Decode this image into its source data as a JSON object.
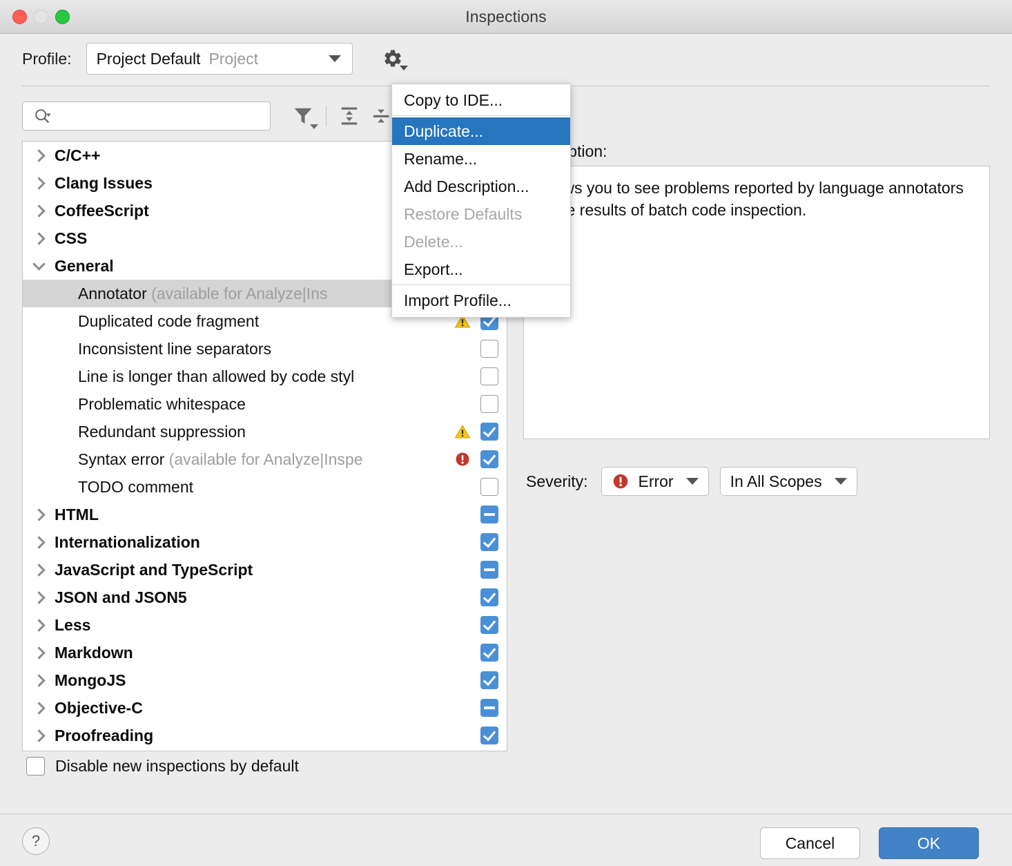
{
  "window": {
    "title": "Inspections"
  },
  "profile": {
    "label": "Profile:",
    "name": "Project Default",
    "scope": "Project",
    "gear_icon": "gear-icon"
  },
  "toolbar": {
    "search_placeholder": "",
    "search_value": "",
    "filter_icon": "filter-icon",
    "expand_all_icon": "expand-all-icon",
    "collapse_all_icon": "collapse-all-icon"
  },
  "menu": {
    "items": [
      {
        "label": "Copy to IDE...",
        "state": "normal"
      },
      {
        "separator": true
      },
      {
        "label": "Duplicate...",
        "state": "highlight"
      },
      {
        "label": "Rename...",
        "state": "normal"
      },
      {
        "label": "Add Description...",
        "state": "normal"
      },
      {
        "label": "Restore Defaults",
        "state": "disabled"
      },
      {
        "label": "Delete...",
        "state": "disabled"
      },
      {
        "label": "Export...",
        "state": "normal"
      },
      {
        "separator": true
      },
      {
        "label": "Import Profile...",
        "state": "normal"
      }
    ]
  },
  "tree": {
    "rows": [
      {
        "type": "group",
        "label": "C/C++",
        "twisty": "closed",
        "check": null,
        "sev": null
      },
      {
        "type": "group",
        "label": "Clang Issues",
        "twisty": "closed",
        "check": null,
        "sev": null
      },
      {
        "type": "group",
        "label": "CoffeeScript",
        "twisty": "closed",
        "check": null,
        "sev": null
      },
      {
        "type": "group",
        "label": "CSS",
        "twisty": "closed",
        "check": null,
        "sev": null
      },
      {
        "type": "group",
        "label": "General",
        "twisty": "open",
        "check": null,
        "sev": null
      },
      {
        "type": "leaf",
        "label": "Annotator",
        "dim": " (available for Analyze|Ins",
        "selected": true,
        "check": null,
        "sev": null
      },
      {
        "type": "leaf",
        "label": "Duplicated code fragment",
        "dim": "",
        "check": "on",
        "sev": "warning"
      },
      {
        "type": "leaf",
        "label": "Inconsistent line separators",
        "dim": "",
        "check": "off",
        "sev": null
      },
      {
        "type": "leaf",
        "label": "Line is longer than allowed by code styl",
        "dim": "",
        "check": "off",
        "sev": null
      },
      {
        "type": "leaf",
        "label": "Problematic whitespace",
        "dim": "",
        "check": "off",
        "sev": null
      },
      {
        "type": "leaf",
        "label": "Redundant suppression",
        "dim": "",
        "check": "on",
        "sev": "warning"
      },
      {
        "type": "leaf",
        "label": "Syntax error",
        "dim": " (available for Analyze|Inspe",
        "check": "on",
        "sev": "error"
      },
      {
        "type": "leaf",
        "label": "TODO comment",
        "dim": "",
        "check": "off",
        "sev": null
      },
      {
        "type": "group",
        "label": "HTML",
        "twisty": "closed",
        "check": "part",
        "sev": null
      },
      {
        "type": "group",
        "label": "Internationalization",
        "twisty": "closed",
        "check": "on",
        "sev": null
      },
      {
        "type": "group",
        "label": "JavaScript and TypeScript",
        "twisty": "closed",
        "check": "part",
        "sev": null
      },
      {
        "type": "group",
        "label": "JSON and JSON5",
        "twisty": "closed",
        "check": "on",
        "sev": null
      },
      {
        "type": "group",
        "label": "Less",
        "twisty": "closed",
        "check": "on",
        "sev": null
      },
      {
        "type": "group",
        "label": "Markdown",
        "twisty": "closed",
        "check": "on",
        "sev": null
      },
      {
        "type": "group",
        "label": "MongoJS",
        "twisty": "closed",
        "check": "on",
        "sev": null
      },
      {
        "type": "group",
        "label": "Objective-C",
        "twisty": "closed",
        "check": "part",
        "sev": null
      },
      {
        "type": "group",
        "label": "Proofreading",
        "twisty": "closed",
        "check": "on",
        "sev": null
      }
    ]
  },
  "disable_new": {
    "label": "Disable new inspections by default",
    "checked": false
  },
  "description": {
    "label": "Description:",
    "text": "Allows you to see problems reported by language annotators in the results of batch code inspection."
  },
  "severity": {
    "label": "Severity:",
    "value": "Error",
    "icon": "error-icon",
    "scope_value": "In All Scopes"
  },
  "footer": {
    "help_label": "?",
    "cancel_label": "Cancel",
    "ok_label": "OK"
  },
  "colors": {
    "accent_blue": "#4a90d9",
    "menu_highlight": "#2675bf",
    "ok_button": "#4282c6",
    "warning": "#f5c518",
    "error": "#c0392b"
  }
}
